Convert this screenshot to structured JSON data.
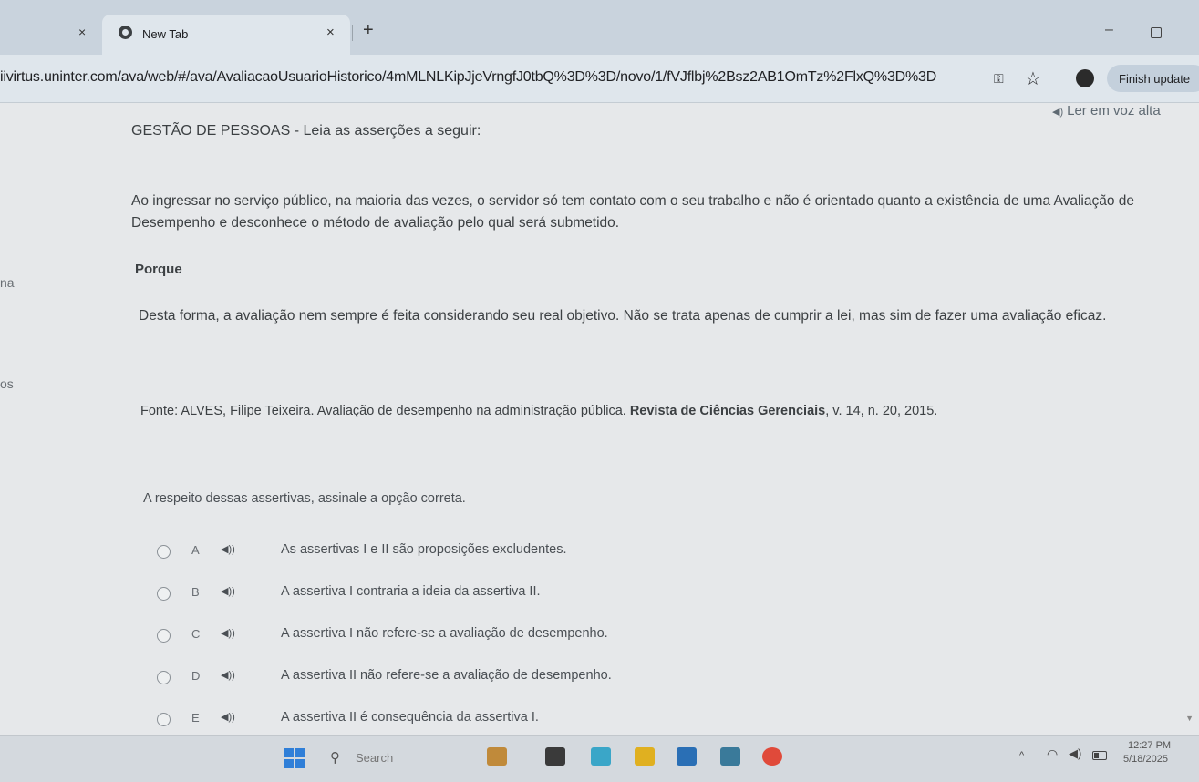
{
  "browser": {
    "prev_tab_close": "×",
    "tab": {
      "title": "New Tab",
      "close": "×"
    },
    "new_tab": "+",
    "window_min": "–",
    "url": "iivirtus.uninter.com/ava/web/#/ava/AvaliacaoUsuarioHistorico/4mMLNLKipJjeVrngfJ0tbQ%3D%3D/novo/1/fVJflbj%2Bsz2AB1OmTz%2FlxQ%3D%3D",
    "finish_update": "Finish update"
  },
  "page": {
    "read_aloud": "Ler em voz alta",
    "title": "GESTÃO DE PESSOAS - Leia as asserções a seguir:",
    "assertion_1": "Ao ingressar no serviço público, na maioria das vezes, o servidor só tem contato com o seu trabalho e não é orientado quanto a existência de uma Avaliação de Desempenho e desconhece o método de avaliação pelo qual será submetido.",
    "porque": "Porque",
    "assertion_2": "Desta forma, a avaliação nem sempre é feita considerando seu real objetivo. Não se trata apenas de cumprir a lei, mas sim de fazer uma avaliação eficaz.",
    "source_prefix": "Fonte: ALVES, Filipe Teixeira. Avaliação de desempenho na administração pública. ",
    "source_journal": "Revista de Ciências Gerenciais",
    "source_suffix": ", v. 14, n. 20, 2015.",
    "prompt": "A respeito dessas assertivas, assinale a opção correta.",
    "left_fragments": [
      "na",
      "os"
    ],
    "options": [
      {
        "letter": "A",
        "text": "As assertivas I e II são proposições excludentes."
      },
      {
        "letter": "B",
        "text": "A assertiva I contraria a ideia da assertiva II."
      },
      {
        "letter": "C",
        "text": "A assertiva I não refere-se a avaliação de desempenho."
      },
      {
        "letter": "D",
        "text": "A assertiva II não refere-se a avaliação de desempenho."
      },
      {
        "letter": "E",
        "text": "A assertiva II é consequência da assertiva I."
      }
    ]
  },
  "taskbar": {
    "search_label": "Search",
    "time": "12:27 PM",
    "date": "5/18/2025",
    "app_colors": [
      "#c08a3a",
      "#3a3a3a",
      "#3aa6c8",
      "#e0b020",
      "#2a6fb5",
      "#3a7a9a",
      "#e04a3a"
    ]
  },
  "colors": {
    "accent": "#2f7fd8",
    "page_bg": "#e6e8ea",
    "chrome_bg": "#dfe6ec"
  }
}
